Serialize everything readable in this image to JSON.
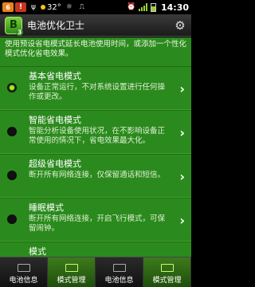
{
  "statusbar": {
    "notif1": "6",
    "notif2": "!",
    "temperature": "32°",
    "time": "14:30"
  },
  "titlebar": {
    "logo_letter": "B",
    "logo_sub": "3",
    "title": "电池优化卫士"
  },
  "description": "使用预设省电模式延长电池使用时间，或添加一个性化模式优化省电效果。",
  "modes": [
    {
      "title": "基本省电模式",
      "subtitle": "设备正常运行，不对系统设置进行任何操作或更改。",
      "selected": true
    },
    {
      "title": "智能省电模式",
      "subtitle": "智能分析设备使用状况，在不影响设备正常使用的情况下，省电效果最大化。",
      "selected": false
    },
    {
      "title": "超级省电模式",
      "subtitle": "断开所有网络连接，仅保留通话和短信。",
      "selected": false
    },
    {
      "title": "睡眠模式",
      "subtitle": "断开所有网络连接，开启飞行模式，可保留闹钟。",
      "selected": false
    },
    {
      "title": "模式",
      "subtitle": "",
      "selected": false
    }
  ],
  "tabs": [
    {
      "label": "电池信息",
      "active": false
    },
    {
      "label": "模式管理",
      "active": true
    },
    {
      "label": "电池信息",
      "active": false
    },
    {
      "label": "模式管理",
      "active": true
    }
  ]
}
